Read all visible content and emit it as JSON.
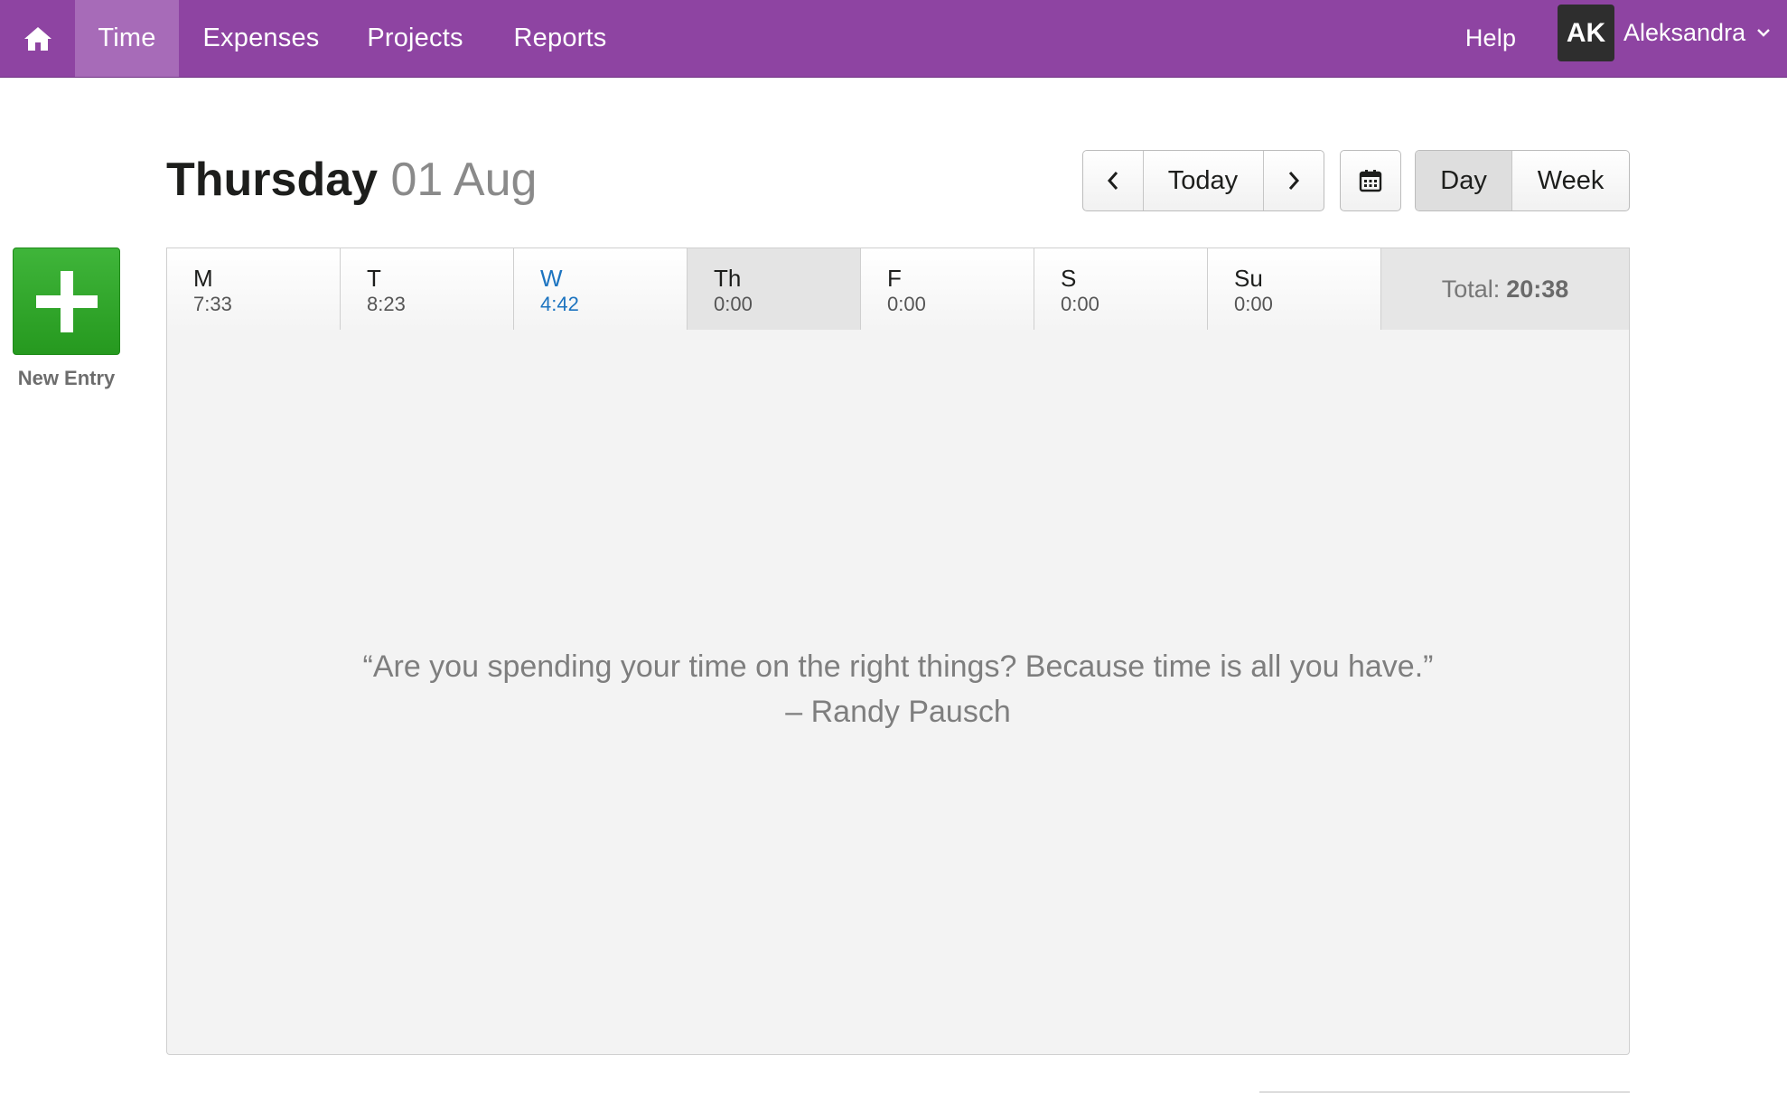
{
  "nav": {
    "home_icon": "home-icon",
    "links": [
      "Time",
      "Expenses",
      "Projects",
      "Reports"
    ],
    "active": "Time",
    "help": "Help",
    "avatar_initials": "AK",
    "user_name": "Aleksandra",
    "user_menu_icon": "chevron-down-icon",
    "brand_color": "#8e44a2"
  },
  "new_entry": {
    "label": "New Entry",
    "icon": "plus-icon",
    "color": "#26991f"
  },
  "header": {
    "day": "Thursday",
    "date": "01 Aug"
  },
  "controls": {
    "prev_icon": "chevron-left-icon",
    "today": "Today",
    "next_icon": "chevron-right-icon",
    "calendar_icon": "calendar-icon",
    "view_day": "Day",
    "view_week": "Week",
    "active_view": "Day"
  },
  "week": {
    "days": [
      {
        "name": "M",
        "time": "7:33"
      },
      {
        "name": "T",
        "time": "8:23"
      },
      {
        "name": "W",
        "time": "4:42"
      },
      {
        "name": "Th",
        "time": "0:00"
      },
      {
        "name": "F",
        "time": "0:00"
      },
      {
        "name": "S",
        "time": "0:00"
      },
      {
        "name": "Su",
        "time": "0:00"
      }
    ],
    "selected": "Th",
    "today": "W",
    "total_label": "Total:",
    "total_value": "20:38"
  },
  "empty_state": {
    "quote": "“Are you spending your time on the right things? Because time is all you have.”",
    "author": "– Randy Pausch"
  }
}
